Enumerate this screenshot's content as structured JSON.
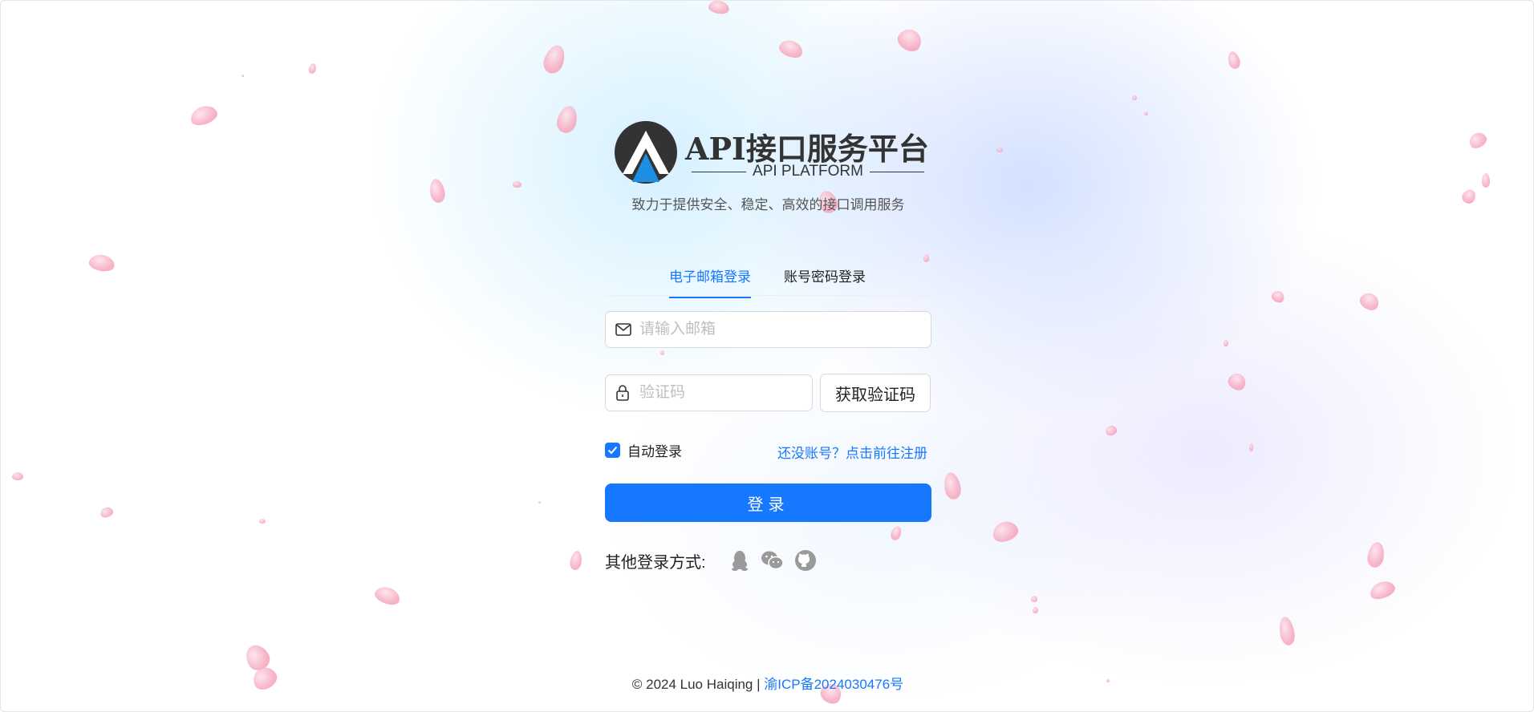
{
  "brand": {
    "title": "API接口服务平台",
    "subtitle": "API PLATFORM",
    "tagline": "致力于提供安全、稳定、高效的接口调用服务"
  },
  "tabs": [
    {
      "label": "电子邮箱登录",
      "active": true
    },
    {
      "label": "账号密码登录",
      "active": false
    }
  ],
  "form": {
    "email_placeholder": "请输入邮箱",
    "email_value": "",
    "code_placeholder": "验证码",
    "code_value": "",
    "get_code_label": "获取验证码",
    "remember_label": "自动登录",
    "remember_checked": true,
    "register_link": "还没账号？点击前往注册",
    "submit_label": "登录"
  },
  "other_login": {
    "label": "其他登录方式:",
    "icons": [
      "qq-icon",
      "wechat-icon",
      "github-icon"
    ]
  },
  "footer": {
    "copyright": "2024 Luo Haiqing |",
    "icp": "渝ICP备2024030476号"
  },
  "colors": {
    "accent": "#1677ff",
    "petal": "#f7a9bf"
  }
}
